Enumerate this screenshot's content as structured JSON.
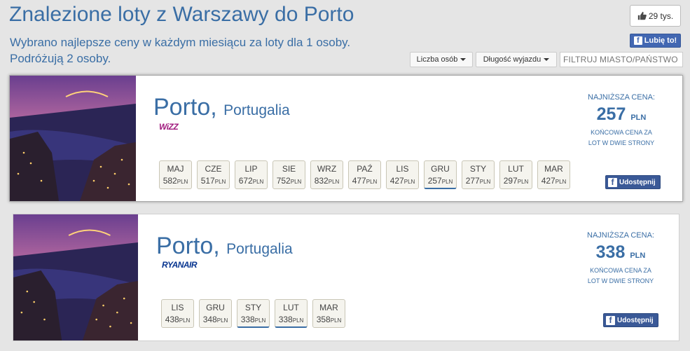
{
  "header": {
    "title": "Znalezione loty z Warszawy do Porto",
    "subtitle_line1": "Wybrano najlepsze ceny w każdym miesiącu za loty dla 1 osoby.",
    "subtitle_line2": "Podróżują 2 osoby."
  },
  "social": {
    "like_count": "29 tys.",
    "like_button": "Lubię to!"
  },
  "filters": {
    "persons": "Liczba osób",
    "duration": "Długość wyjazdu",
    "search_placeholder": "FILTRUJ MIASTO/PAŃSTWO"
  },
  "results": [
    {
      "city": "Porto",
      "country": "Portugalia",
      "airline": "WiZZ",
      "price_label": "NAJNIŻSZA CENA:",
      "price_value": "257",
      "price_currency": "PLN",
      "price_note_line1": "KOŃCOWA CENA ZA",
      "price_note_line2": "LOT W DWIE STRONY",
      "share": "Udostępnij",
      "months": [
        {
          "name": "MAJ",
          "price": "582",
          "currency": "PLN",
          "selected": false
        },
        {
          "name": "CZE",
          "price": "517",
          "currency": "PLN",
          "selected": false
        },
        {
          "name": "LIP",
          "price": "672",
          "currency": "PLN",
          "selected": false
        },
        {
          "name": "SIE",
          "price": "752",
          "currency": "PLN",
          "selected": false
        },
        {
          "name": "WRZ",
          "price": "832",
          "currency": "PLN",
          "selected": false
        },
        {
          "name": "PAŹ",
          "price": "477",
          "currency": "PLN",
          "selected": false
        },
        {
          "name": "LIS",
          "price": "427",
          "currency": "PLN",
          "selected": false
        },
        {
          "name": "GRU",
          "price": "257",
          "currency": "PLN",
          "selected": true
        },
        {
          "name": "STY",
          "price": "277",
          "currency": "PLN",
          "selected": false
        },
        {
          "name": "LUT",
          "price": "297",
          "currency": "PLN",
          "selected": false
        },
        {
          "name": "MAR",
          "price": "427",
          "currency": "PLN",
          "selected": false
        }
      ]
    },
    {
      "city": "Porto",
      "country": "Portugalia",
      "airline": "RYANAIR",
      "price_label": "NAJNIŻSZA CENA:",
      "price_value": "338",
      "price_currency": "PLN",
      "price_note_line1": "KOŃCOWA CENA ZA",
      "price_note_line2": "LOT W DWIE STRONY",
      "share": "Udostępnij",
      "months": [
        {
          "name": "LIS",
          "price": "438",
          "currency": "PLN",
          "selected": false
        },
        {
          "name": "GRU",
          "price": "348",
          "currency": "PLN",
          "selected": false
        },
        {
          "name": "STY",
          "price": "338",
          "currency": "PLN",
          "selected": true
        },
        {
          "name": "LUT",
          "price": "338",
          "currency": "PLN",
          "selected": true
        },
        {
          "name": "MAR",
          "price": "358",
          "currency": "PLN",
          "selected": false
        }
      ]
    }
  ]
}
